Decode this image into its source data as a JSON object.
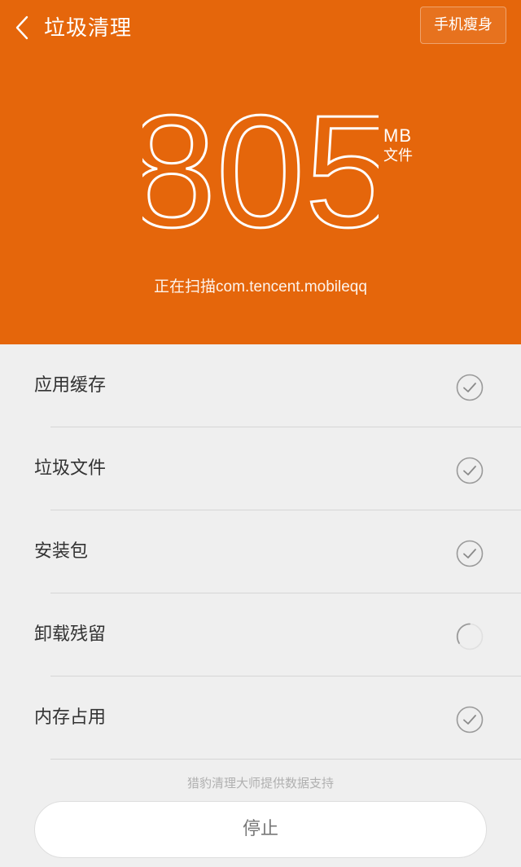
{
  "header": {
    "title": "垃圾清理",
    "slim_button_label": "手机瘦身",
    "size_value": "805",
    "size_unit": "MB",
    "size_unit_sub": "文件",
    "scan_status": "正在扫描com.tencent.mobileqq",
    "accent_color": "#e5660b"
  },
  "categories": [
    {
      "label": "应用缓存",
      "status": "done",
      "icon": "check-circle-icon"
    },
    {
      "label": "垃圾文件",
      "status": "done",
      "icon": "check-circle-icon"
    },
    {
      "label": "安装包",
      "status": "done",
      "icon": "check-circle-icon"
    },
    {
      "label": "卸载残留",
      "status": "scanning",
      "icon": "loading-spinner-icon"
    },
    {
      "label": "内存占用",
      "status": "done",
      "icon": "check-circle-icon"
    }
  ],
  "footer": {
    "credit": "猎豹清理大师提供数据支持",
    "stop_label": "停止"
  }
}
